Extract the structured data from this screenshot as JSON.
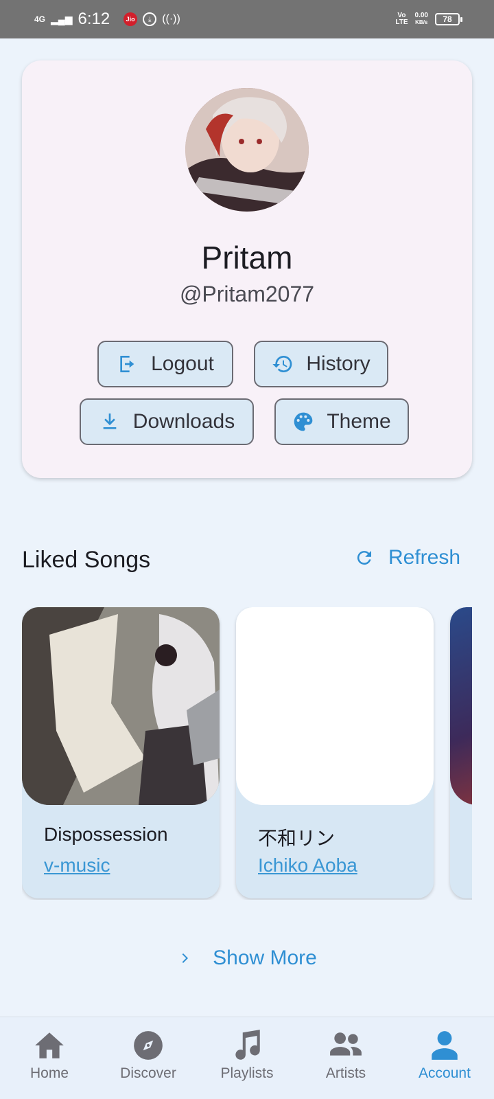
{
  "status_bar": {
    "network": "4G",
    "time": "6:12",
    "carrier": "Jio",
    "volte": "Vo\nLTE",
    "speed": "0.00",
    "speed_unit": "KB/s",
    "battery": "78"
  },
  "profile": {
    "name": "Pritam",
    "handle": "@Pritam2077",
    "buttons": {
      "logout": "Logout",
      "history": "History",
      "downloads": "Downloads",
      "theme": "Theme"
    }
  },
  "liked_songs": {
    "title": "Liked Songs",
    "refresh_label": "Refresh",
    "songs": [
      {
        "title": "Dispossession",
        "artist": "v-music"
      },
      {
        "title": "不和リン",
        "artist": "Ichiko Aoba"
      }
    ],
    "show_more_label": "Show More"
  },
  "nav": {
    "items": [
      {
        "label": "Home",
        "icon": "home-icon"
      },
      {
        "label": "Discover",
        "icon": "compass-icon"
      },
      {
        "label": "Playlists",
        "icon": "music-note-icon"
      },
      {
        "label": "Artists",
        "icon": "people-icon"
      },
      {
        "label": "Account",
        "icon": "person-icon"
      }
    ],
    "active": "Account"
  },
  "colors": {
    "accent": "#2f8fd3",
    "background": "#ecf3fb",
    "card": "#f8f1f8",
    "button_fill": "#dae9f5"
  }
}
